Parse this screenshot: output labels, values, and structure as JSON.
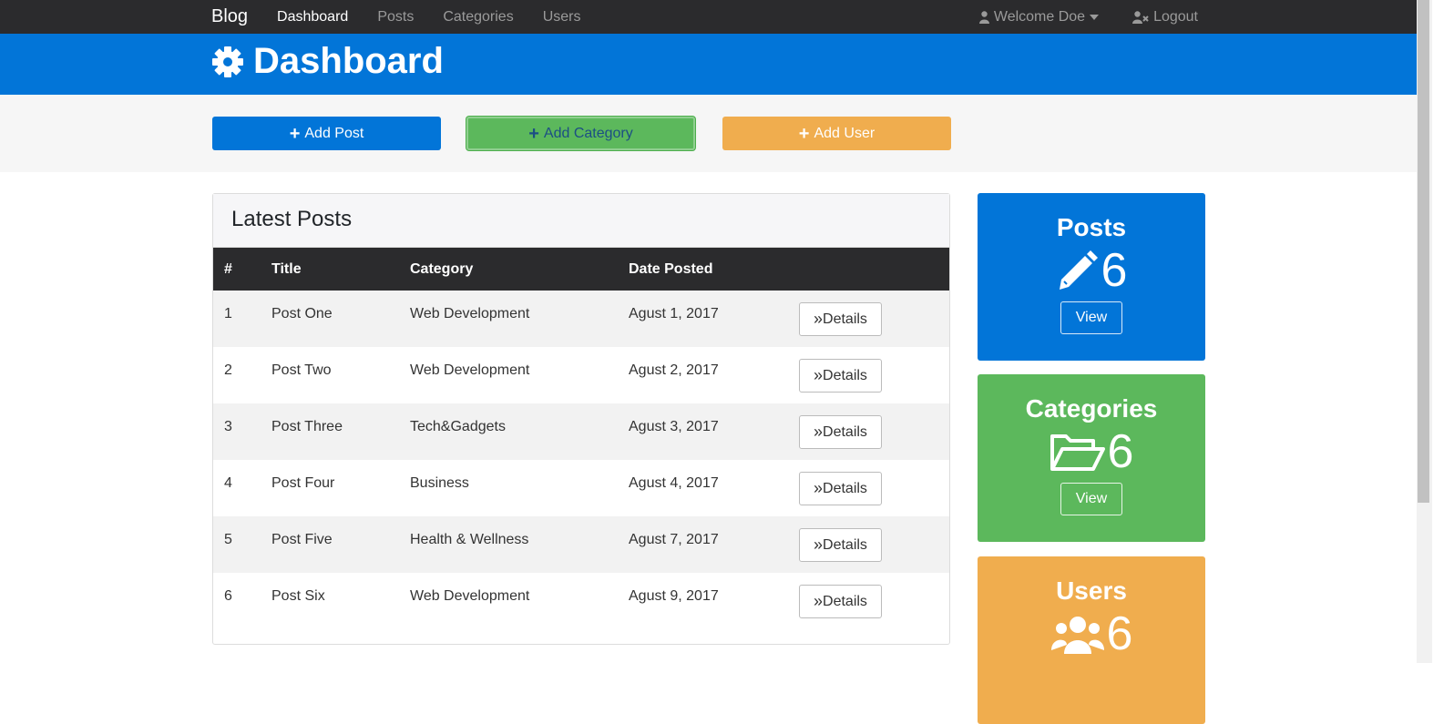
{
  "navbar": {
    "brand": "Blog",
    "links": [
      "Dashboard",
      "Posts",
      "Categories",
      "Users"
    ],
    "welcome": "Welcome Doe",
    "logout": "Logout"
  },
  "header": {
    "title": "Dashboard"
  },
  "actions": {
    "add_post": "Add Post",
    "add_category": "Add Category",
    "add_user": "Add User"
  },
  "latest_posts": {
    "title": "Latest Posts",
    "columns": [
      "#",
      "Title",
      "Category",
      "Date Posted"
    ],
    "details_label": "Details",
    "rows": [
      {
        "num": "1",
        "title": "Post One",
        "category": "Web Development",
        "date": "Agust 1, 2017"
      },
      {
        "num": "2",
        "title": "Post Two",
        "category": "Web Development",
        "date": "Agust 2, 2017"
      },
      {
        "num": "3",
        "title": "Post Three",
        "category": "Tech&Gadgets",
        "date": "Agust 3, 2017"
      },
      {
        "num": "4",
        "title": "Post Four",
        "category": "Business",
        "date": "Agust 4, 2017"
      },
      {
        "num": "5",
        "title": "Post Five",
        "category": "Health & Wellness",
        "date": "Agust 7, 2017"
      },
      {
        "num": "6",
        "title": "Post Six",
        "category": "Web Development",
        "date": "Agust 9, 2017"
      }
    ]
  },
  "stats": {
    "posts": {
      "title": "Posts",
      "count": "6",
      "view": "View",
      "icon": "pencil-icon"
    },
    "categories": {
      "title": "Categories",
      "count": "6",
      "view": "View",
      "icon": "folder-open-icon"
    },
    "users": {
      "title": "Users",
      "count": "6",
      "icon": "users-icon"
    }
  },
  "colors": {
    "primary": "#0275d8",
    "success": "#5cb85c",
    "warning": "#f0ad4e",
    "dark": "#2b2b2d"
  }
}
